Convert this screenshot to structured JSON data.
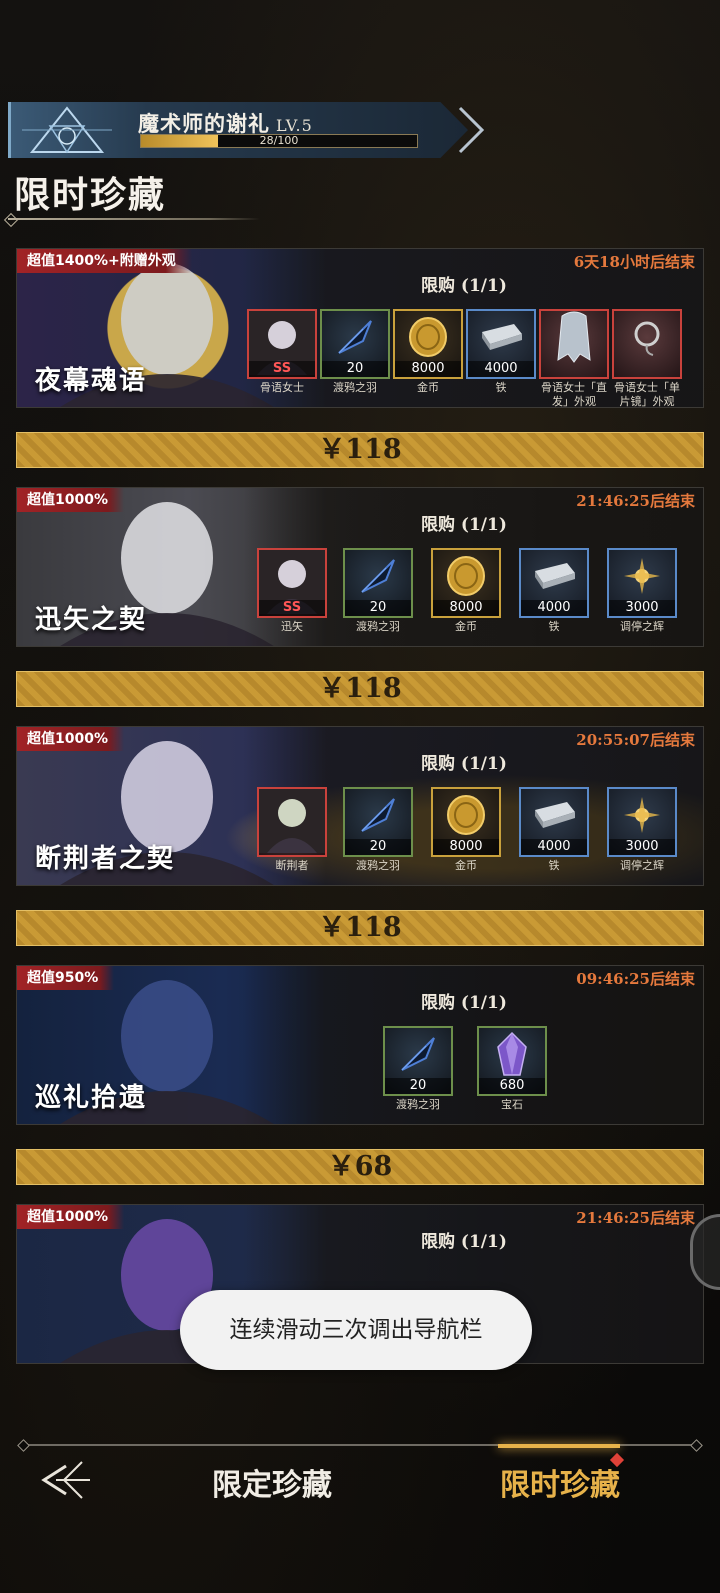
{
  "level": {
    "title": "魔术师的谢礼",
    "level_label": "LV.5",
    "progress_text": "28/100",
    "progress_fraction": 0.28
  },
  "page_title": "限时珍藏",
  "cards": [
    {
      "badge": "超值1400%+附赠外观",
      "timer": "6天18小时后结束",
      "limit": "限购 (1/1)",
      "name": "夜幕魂语",
      "price": "￥118",
      "items": [
        {
          "qty": "SS",
          "name": "骨语女士",
          "frame": "red",
          "icon": "lady-portrait-icon"
        },
        {
          "qty": "20",
          "name": "渡鸦之羽",
          "frame": "green",
          "icon": "raven-feather-icon"
        },
        {
          "qty": "8000",
          "name": "金币",
          "frame": "gold",
          "icon": "gold-coin-icon"
        },
        {
          "qty": "4000",
          "name": "铁",
          "frame": "blue",
          "icon": "iron-ingot-icon"
        },
        {
          "qty": "",
          "name": "骨语女士「直发」外观",
          "frame": "red",
          "icon": "hair-icon"
        },
        {
          "qty": "",
          "name": "骨语女士「单片镜」外观",
          "frame": "red",
          "icon": "monocle-icon"
        }
      ]
    },
    {
      "badge": "超值1000%",
      "timer": "21:46:25后结束",
      "limit": "限购 (1/1)",
      "name": "迅矢之契",
      "price": "￥118",
      "items": [
        {
          "qty": "SS",
          "name": "迅矢",
          "frame": "red",
          "icon": "archer-portrait-icon"
        },
        {
          "qty": "20",
          "name": "渡鸦之羽",
          "frame": "green",
          "icon": "raven-feather-icon"
        },
        {
          "qty": "8000",
          "name": "金币",
          "frame": "gold",
          "icon": "gold-coin-icon"
        },
        {
          "qty": "4000",
          "name": "铁",
          "frame": "blue",
          "icon": "iron-ingot-icon"
        },
        {
          "qty": "3000",
          "name": "调停之辉",
          "frame": "blue",
          "icon": "radiance-icon"
        }
      ]
    },
    {
      "badge": "超值1000%",
      "timer": "20:55:07后结束",
      "limit": "限购 (1/1)",
      "name": "断荆者之契",
      "price": "￥118",
      "items": [
        {
          "qty": "",
          "name": "断荆者",
          "frame": "red",
          "icon": "elf-portrait-icon"
        },
        {
          "qty": "20",
          "name": "渡鸦之羽",
          "frame": "green",
          "icon": "raven-feather-icon"
        },
        {
          "qty": "8000",
          "name": "金币",
          "frame": "gold",
          "icon": "gold-coin-icon"
        },
        {
          "qty": "4000",
          "name": "铁",
          "frame": "blue",
          "icon": "iron-ingot-icon"
        },
        {
          "qty": "3000",
          "name": "调停之辉",
          "frame": "blue",
          "icon": "radiance-icon"
        }
      ]
    },
    {
      "badge": "超值950%",
      "timer": "09:46:25后结束",
      "limit": "限购 (1/1)",
      "name": "巡礼拾遗",
      "price": "￥68",
      "items": [
        {
          "qty": "20",
          "name": "渡鸦之羽",
          "frame": "green",
          "icon": "raven-feather-icon"
        },
        {
          "qty": "680",
          "name": "宝石",
          "frame": "green",
          "icon": "gem-icon"
        }
      ]
    },
    {
      "badge": "超值1000%",
      "timer": "21:46:25后结束",
      "limit": "限购 (1/1)",
      "name": "",
      "price": "",
      "items": []
    }
  ],
  "toast": "连续滑动三次调出导航栏",
  "nav": {
    "tab1": "限定珍藏",
    "tab2": "限时珍藏",
    "active": "tab2"
  },
  "colors": {
    "accent_gold": "#e7b24a",
    "timer_orange": "#e5793d",
    "badge_red": "#a12326"
  }
}
